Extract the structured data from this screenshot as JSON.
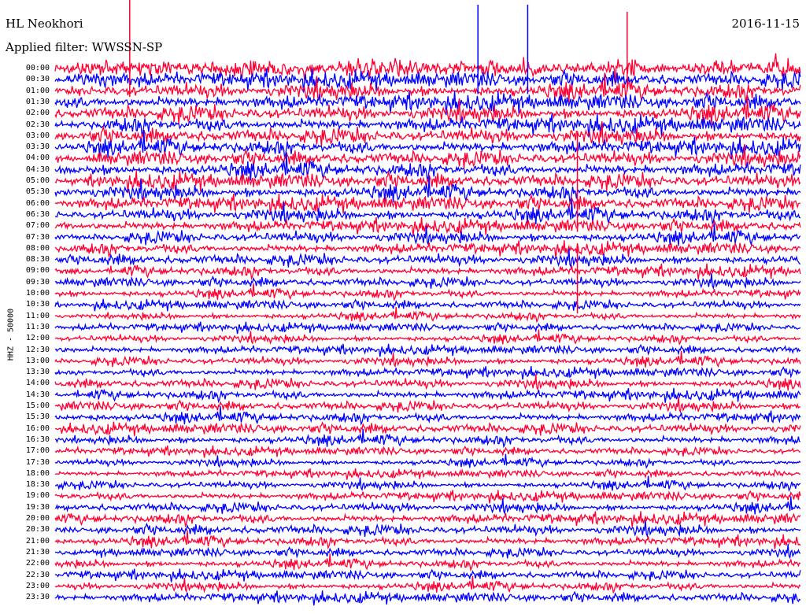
{
  "header": {
    "station": "HL Neokhori",
    "date": "2016-11-15",
    "filter": "Applied filter: WWSSN-SP"
  },
  "colors": {
    "trace_a": "#ff0033",
    "trace_b": "#0000ff",
    "background": "#ffffff",
    "text": "#000000"
  },
  "chart_data": {
    "type": "line",
    "title": "HL Neokhori",
    "subtitle": "Applied filter: WWSSN-SP",
    "date": "2016-11-15",
    "ylabel": "HHZ - 50000",
    "xlabel": "",
    "grid": false,
    "legend": "none",
    "row_labels": [
      "00:00",
      "00:30",
      "01:00",
      "01:30",
      "02:00",
      "02:30",
      "03:00",
      "03:30",
      "04:00",
      "04:30",
      "05:00",
      "05:30",
      "06:00",
      "06:30",
      "07:00",
      "07:30",
      "08:00",
      "08:30",
      "09:00",
      "09:30",
      "10:00",
      "10:30",
      "11:00",
      "11:30",
      "12:00",
      "12:30",
      "13:00",
      "13:30",
      "14:00",
      "14:30",
      "15:00",
      "15:30",
      "16:00",
      "16:30",
      "17:00",
      "17:30",
      "18:00",
      "18:30",
      "19:00",
      "19:30",
      "20:00",
      "20:30",
      "21:00",
      "21:30",
      "22:00",
      "22:30",
      "23:00",
      "23:30"
    ],
    "series_colors": [
      "#ff0033",
      "#0000ff"
    ],
    "row_activity": [
      0.95,
      0.9,
      0.9,
      0.9,
      0.9,
      0.88,
      0.88,
      0.85,
      0.85,
      0.85,
      0.85,
      0.8,
      0.8,
      0.75,
      0.7,
      0.68,
      0.66,
      0.65,
      0.6,
      0.55,
      0.5,
      0.5,
      0.45,
      0.45,
      0.45,
      0.48,
      0.5,
      0.5,
      0.55,
      0.55,
      0.55,
      0.55,
      0.6,
      0.55,
      0.45,
      0.42,
      0.42,
      0.45,
      0.5,
      0.55,
      0.6,
      0.6,
      0.55,
      0.5,
      0.5,
      0.5,
      0.5,
      0.55
    ],
    "spikes": [
      {
        "time": "00:00",
        "minute": 3,
        "amplitude": 1.0,
        "series": 0
      },
      {
        "time": "00:00",
        "minute": 17,
        "amplitude": 0.9,
        "series": 1
      },
      {
        "time": "00:00",
        "minute": 19,
        "amplitude": 0.9,
        "series": 1
      },
      {
        "time": "00:00",
        "minute": 23,
        "amplitude": 0.8,
        "series": 0
      },
      {
        "time": "06:00",
        "minute": 21,
        "amplitude": 1.0,
        "series": 0
      },
      {
        "time": "10:00",
        "minute": 21,
        "amplitude": 0.7,
        "series": 0
      }
    ]
  }
}
